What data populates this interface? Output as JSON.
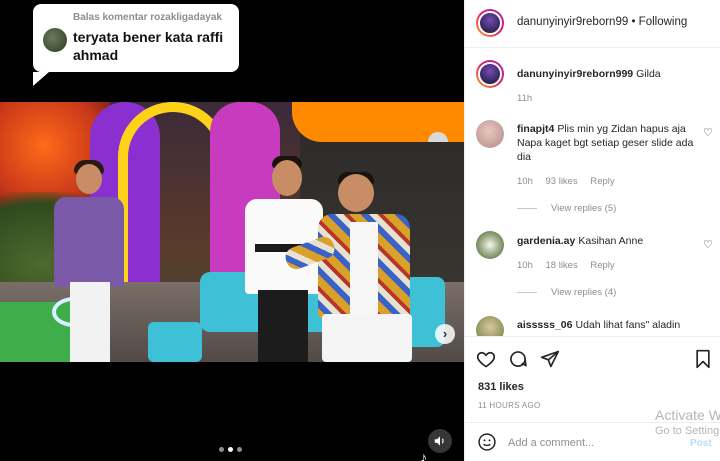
{
  "media": {
    "reply_label": "Balas komentar rozakligadayak",
    "reply_text": "teryata bener kata raffi ahmad",
    "carousel_next": "›",
    "sound_icon": "speaker-icon",
    "dots_count": 3,
    "active_dot": 1
  },
  "header": {
    "username": "danunyinyir9reborn99",
    "separator": " • ",
    "follow_label": "Following"
  },
  "caption": {
    "username": "danunyinyir9reborn999",
    "text": "Gilda",
    "time": "11h"
  },
  "comments": [
    {
      "username": "finapjt4",
      "text": "Plis min yg Zidan hapus aja Napa kaget bgt setiap geser slide ada dia",
      "time": "10h",
      "likes": "93 likes",
      "reply": "Reply",
      "view_replies": "View replies (5)"
    },
    {
      "username": "gardenia.ay",
      "text": "Kasihan Anne",
      "time": "10h",
      "likes": "18 likes",
      "reply": "Reply",
      "view_replies": "View replies (4)"
    },
    {
      "username": "aisssss_06",
      "text": "Udah lihat fans\" aladin"
    }
  ],
  "actions": {
    "like_icon": "heart-icon",
    "comment_icon": "comment-icon",
    "share_icon": "paper-plane-icon",
    "save_icon": "bookmark-icon"
  },
  "likes_count": "831 likes",
  "timestamp": "11 HOURS AGO",
  "add_comment_placeholder": "Add a comment...",
  "post_label": "Post",
  "windows_watermark": {
    "line1": "Activate W",
    "line2": "Go to Setting"
  },
  "colors": {
    "accent_link": "#0095f6",
    "post_disabled": "#b2dffc",
    "muted": "#8e8e8e"
  }
}
